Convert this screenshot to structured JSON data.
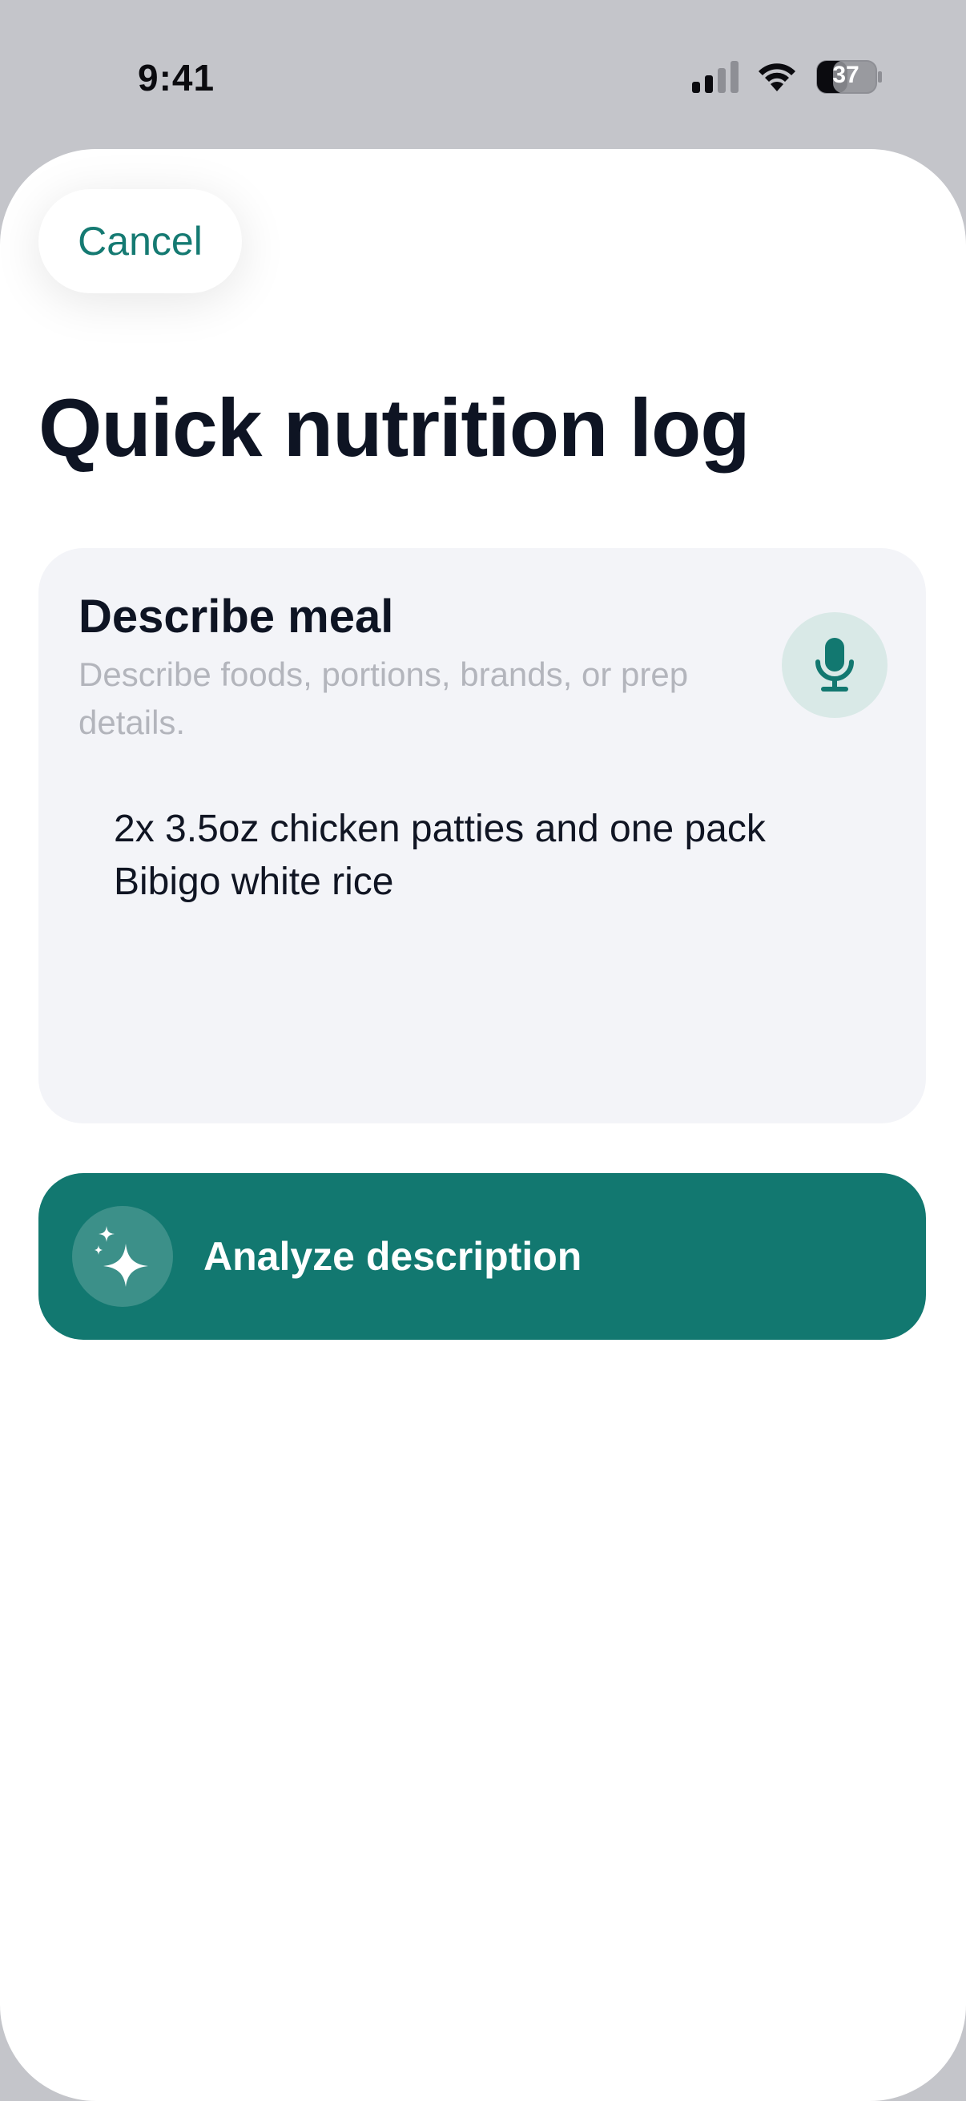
{
  "status_bar": {
    "time": "9:41",
    "battery_level": "37",
    "icons": [
      "signal-icon",
      "wifi-icon",
      "battery-icon"
    ]
  },
  "header": {
    "cancel_label": "Cancel",
    "title": "Quick nutrition log"
  },
  "meal_card": {
    "title": "Describe meal",
    "hint": "Describe foods, portions, brands, or prep details.",
    "input_value": "2x 3.5oz chicken patties and one pack Bibigo white rice",
    "mic_icon": "microphone-icon"
  },
  "analyze": {
    "label": "Analyze description",
    "icon": "sparkles-icon"
  },
  "colors": {
    "accent": "#127870",
    "accent_text": "#157a72",
    "mic_bg": "#d9e9e7",
    "card_bg": "#f3f4f8",
    "title_text": "#0e1423",
    "hint_text": "#b3b5bc",
    "backdrop": "#c4c5ca"
  }
}
